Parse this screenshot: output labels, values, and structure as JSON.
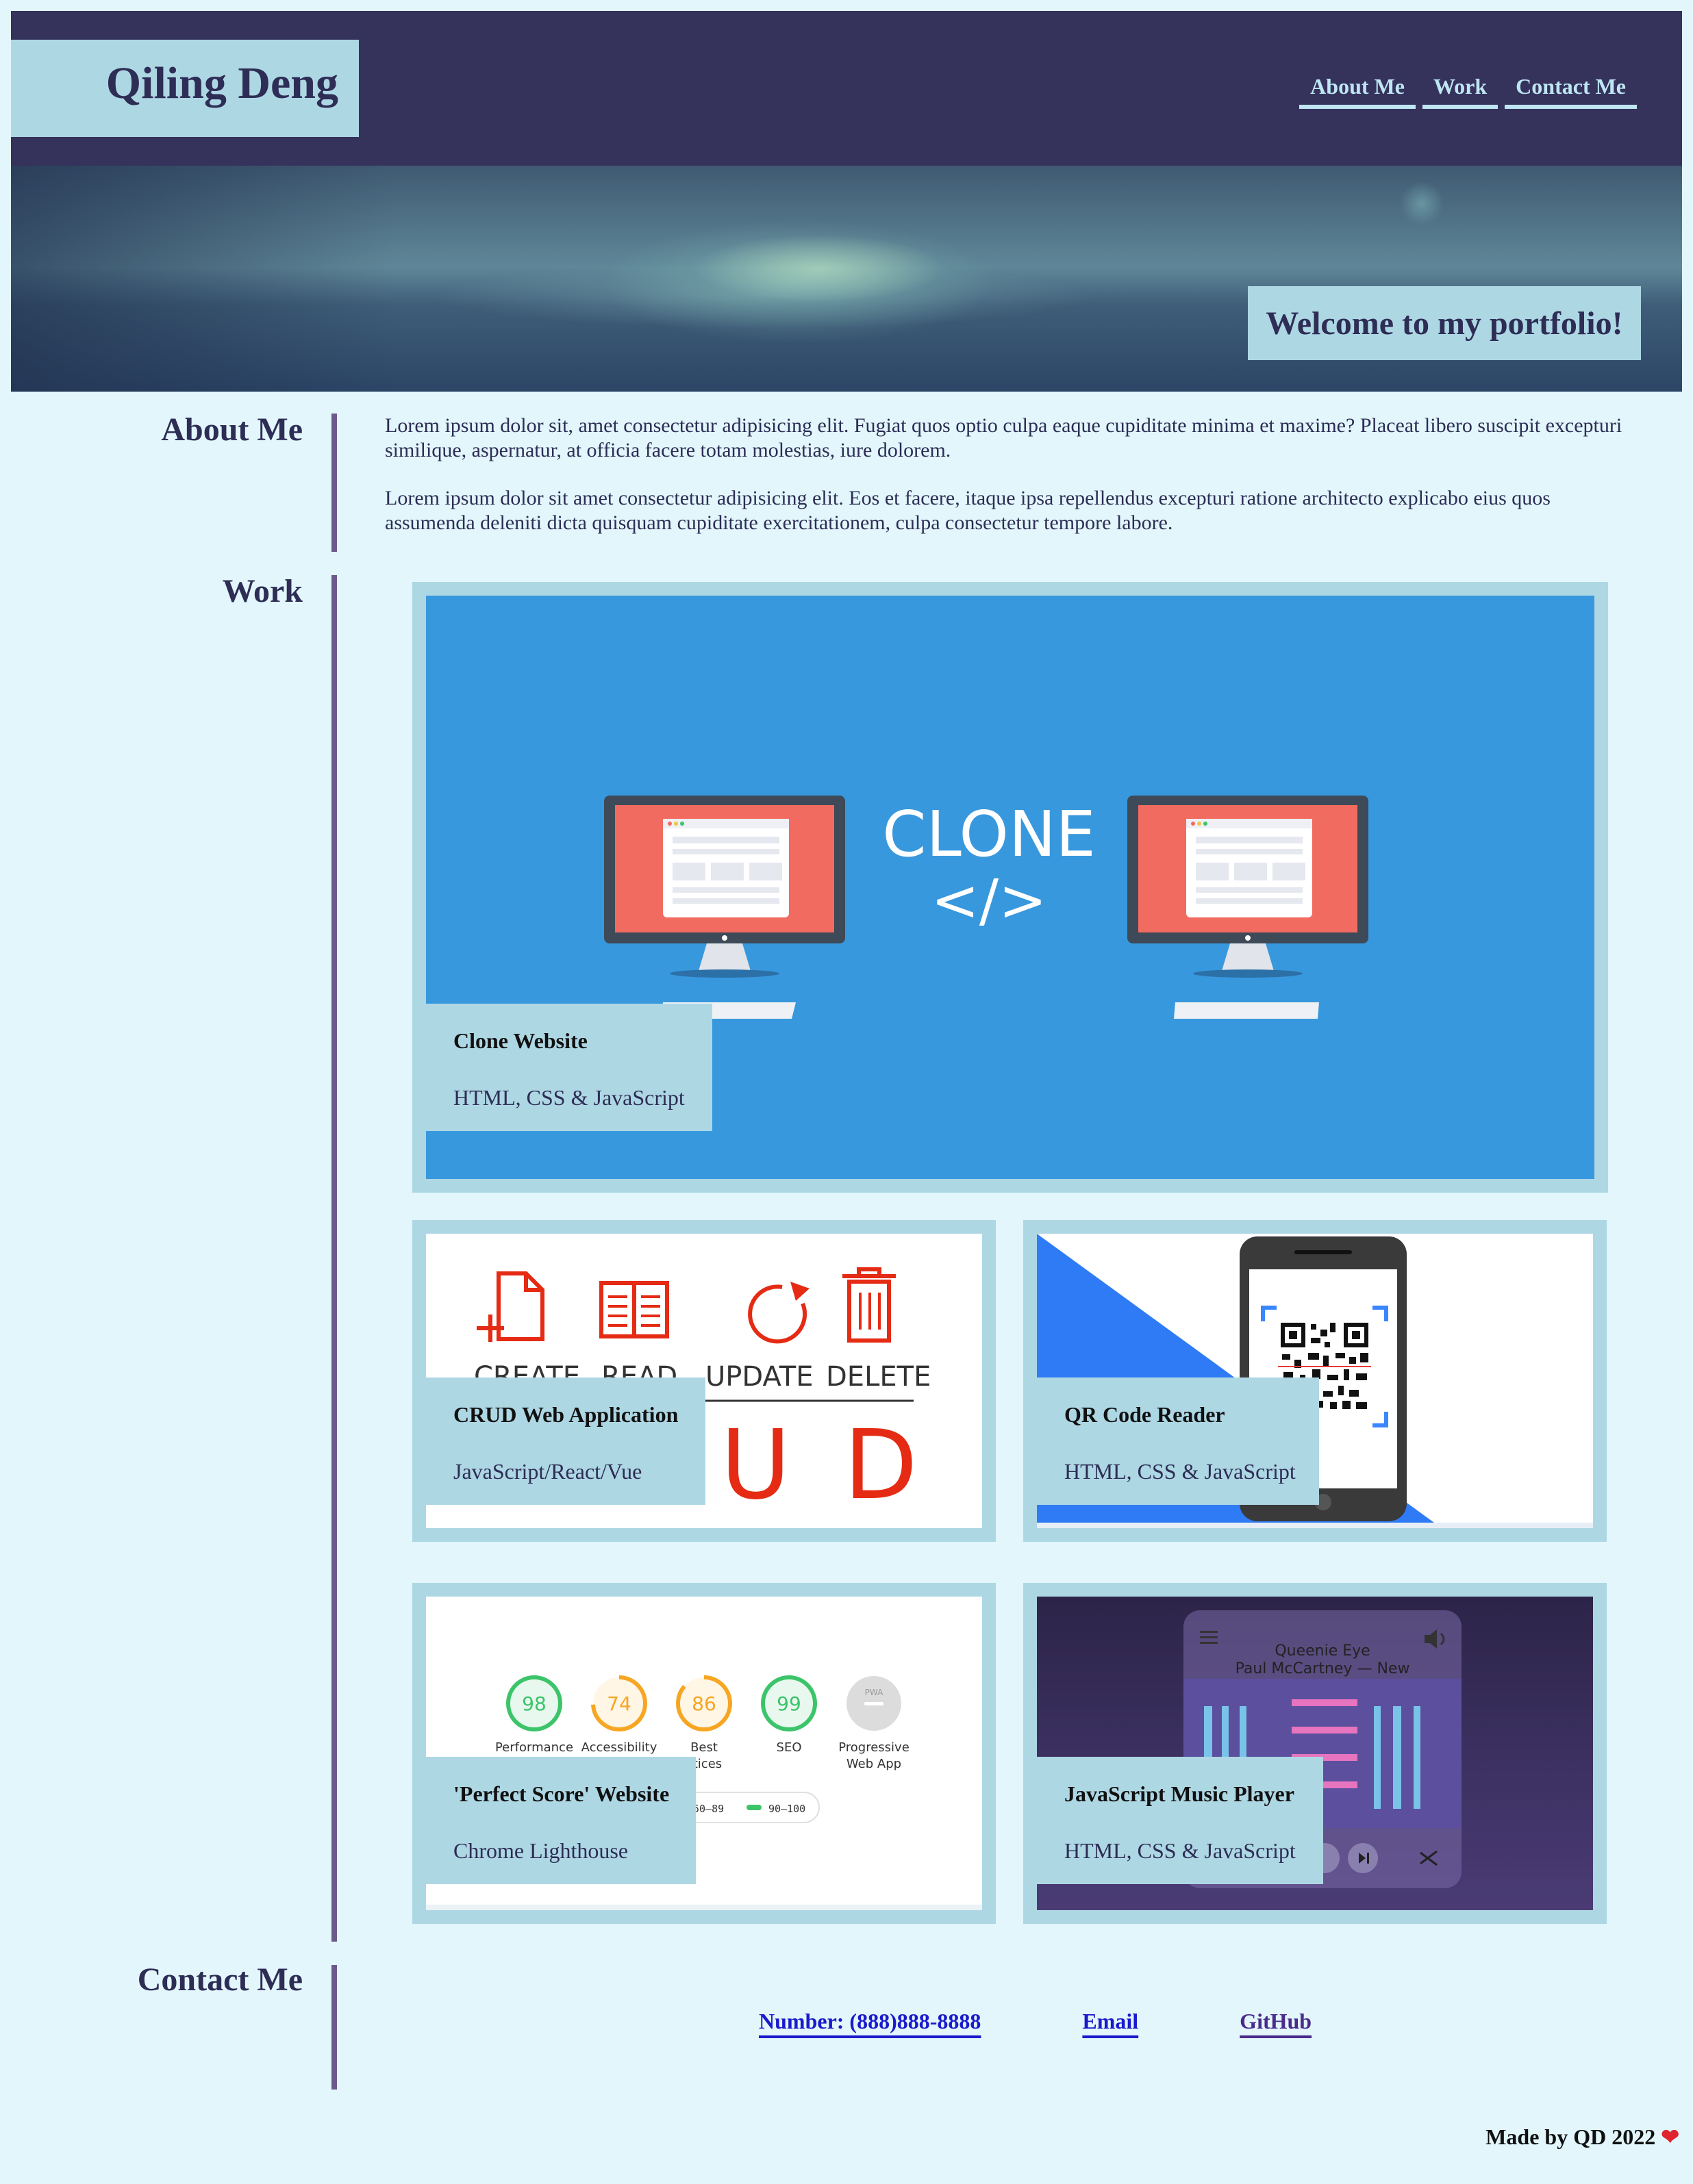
{
  "header": {
    "name": "Qiling Deng",
    "nav": [
      "About Me",
      "Work",
      "Contact Me"
    ]
  },
  "hero": {
    "caption": "Welcome to my portfolio!"
  },
  "about": {
    "title": "About Me",
    "paragraphs": [
      "Lorem ipsum dolor sit, amet consectetur adipisicing elit. Fugiat quos optio culpa eaque cupiditate minima et maxime? Placeat libero suscipit excepturi similique, aspernatur, at officia facere totam molestias, iure dolorem.",
      "Lorem ipsum dolor sit amet consectetur adipisicing elit. Eos et facere, itaque ipsa repellendus excepturi ratione architecto explicabo eius quos assumenda deleniti dicta quisquam cupiditate exercitationem, culpa consectetur tempore labore."
    ]
  },
  "work": {
    "title": "Work",
    "projects": [
      {
        "title": "Clone Website",
        "tech": "HTML, CSS & JavaScript",
        "art_text": "CLONE",
        "art_code": "</>"
      },
      {
        "title": "CRUD Web Application",
        "tech": "JavaScript/React/Vue",
        "art_words": [
          "CREATE",
          "READ",
          "UPDATE",
          "DELETE"
        ],
        "art_letters": [
          "U",
          "D"
        ]
      },
      {
        "title": "QR Code Reader",
        "tech": "HTML, CSS & JavaScript"
      },
      {
        "title": "'Perfect Score' Website",
        "tech": "Chrome Lighthouse",
        "scores": [
          {
            "value": "98",
            "label": "Performance",
            "color": "#3cc46a"
          },
          {
            "value": "74",
            "label": "Accessibility",
            "color": "#f6a623"
          },
          {
            "value": "86",
            "label": "Best",
            "label2": "ctices",
            "color": "#f6a623"
          },
          {
            "value": "99",
            "label": "SEO",
            "color": "#3cc46a"
          },
          {
            "value": "PWA",
            "label": "Progressive",
            "label2": "Web App",
            "color": "#bdbdbd"
          }
        ],
        "legend": [
          "50–89",
          "90–100"
        ]
      },
      {
        "title": "JavaScript Music Player",
        "tech": "HTML, CSS & JavaScript",
        "song": "Queenie Eye",
        "artist": "Paul McCartney — New"
      }
    ]
  },
  "contact": {
    "title": "Contact Me",
    "links": [
      "Number: (888)888-8888",
      "Email",
      "GitHub"
    ]
  },
  "footer": {
    "text": "Made by QD 2022",
    "heart": "❤"
  }
}
